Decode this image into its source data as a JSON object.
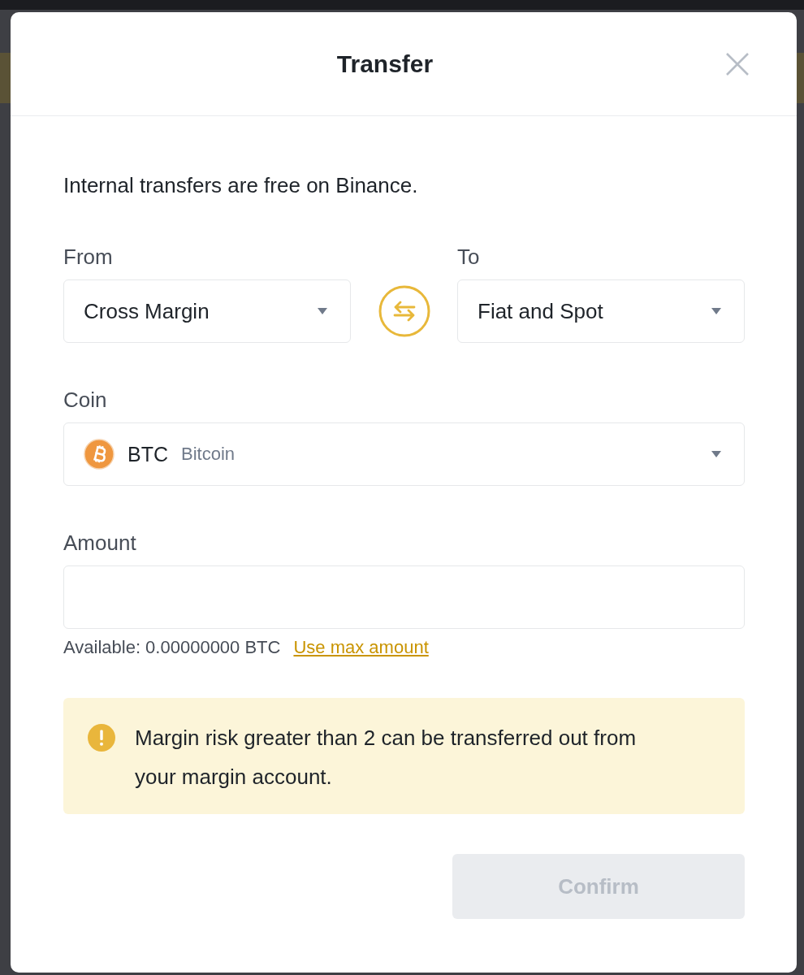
{
  "dialog": {
    "title": "Transfer"
  },
  "notice": "Internal transfers are free on Binance.",
  "from": {
    "label": "From",
    "value": "Cross Margin"
  },
  "to": {
    "label": "To",
    "value": "Fiat and Spot"
  },
  "coin": {
    "label": "Coin",
    "symbol": "BTC",
    "name": "Bitcoin"
  },
  "amount": {
    "label": "Amount"
  },
  "available": {
    "text": "Available: 0.00000000 BTC",
    "link": "Use max amount"
  },
  "alert": {
    "text": "Margin risk greater than 2 can be transferred out from your margin account."
  },
  "confirm_button": {
    "label": "Confirm",
    "disabled": true
  }
}
